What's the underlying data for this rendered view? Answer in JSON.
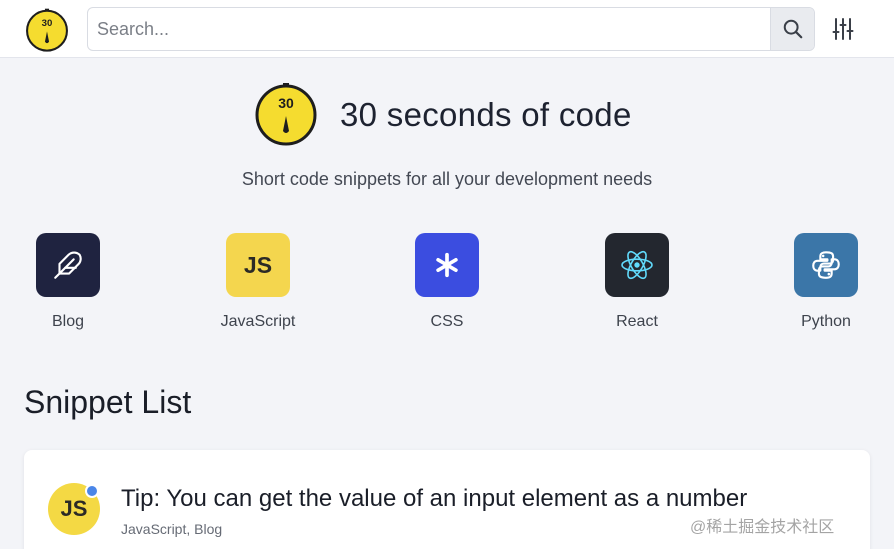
{
  "header": {
    "logo_text": "30",
    "search_placeholder": "Search..."
  },
  "hero": {
    "logo_text": "30",
    "title": "30 seconds of code",
    "subtitle": "Short code snippets for all your development needs"
  },
  "categories": [
    {
      "label": "Blog",
      "icon": "feather-icon",
      "color": "#1f2340"
    },
    {
      "label": "JavaScript",
      "icon": "js-icon",
      "badge": "JS",
      "color": "#f4d64e"
    },
    {
      "label": "CSS",
      "icon": "asterisk-icon",
      "color": "#3b4de0"
    },
    {
      "label": "React",
      "icon": "react-icon",
      "color": "#23272f"
    },
    {
      "label": "Python",
      "icon": "python-icon",
      "color": "#3b76a8"
    }
  ],
  "snippet_list": {
    "title": "Snippet List",
    "items": [
      {
        "avatar": "JS",
        "title": "Tip: You can get the value of an input element as a number",
        "tags": "JavaScript, Blog"
      }
    ]
  },
  "watermark": "@稀土掘金技术社区"
}
